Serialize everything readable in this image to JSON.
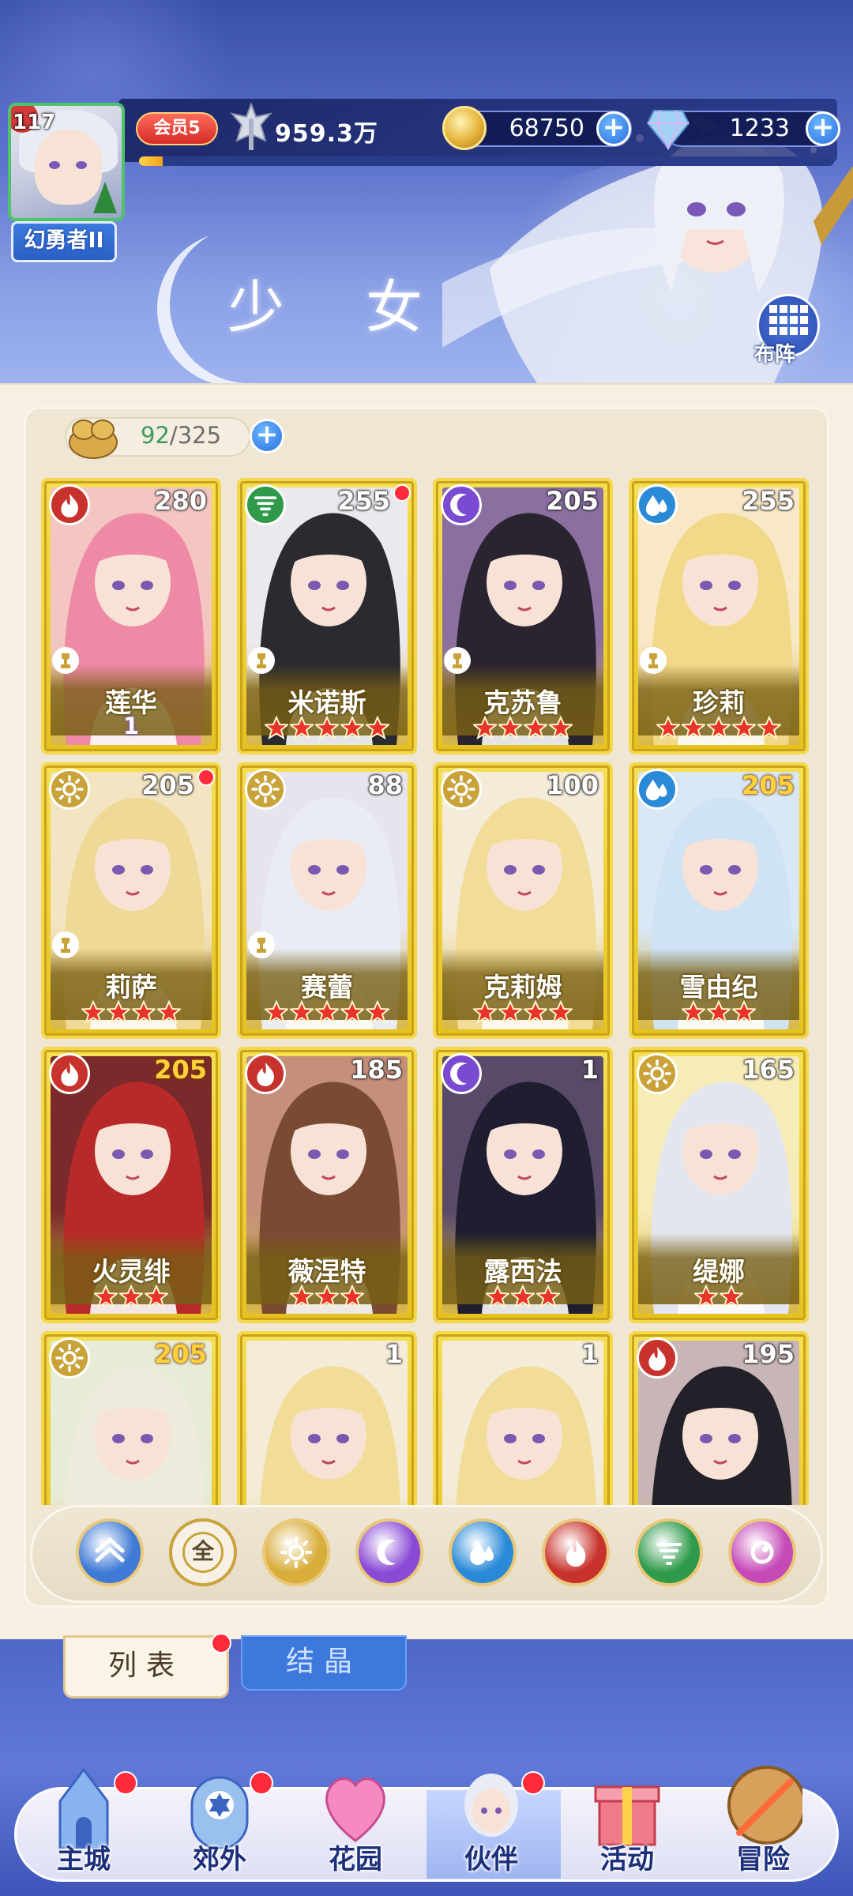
{
  "player": {
    "level": "117",
    "rank": "幻勇者II",
    "vip": "会员5",
    "power": "959.3万",
    "exp_progress": 0.034
  },
  "resources": {
    "coins": "68750",
    "gems": "1233"
  },
  "header": {
    "title": "少 女",
    "formation_label": "布阵"
  },
  "collection": {
    "owned": "92",
    "separator": "/",
    "capacity": "325"
  },
  "cards": [
    {
      "name": "莲华",
      "level": "280",
      "element": "fire",
      "stars": 0,
      "wing": "1",
      "gold": false,
      "dot": false,
      "chess": true
    },
    {
      "name": "米诺斯",
      "level": "255",
      "element": "wind",
      "stars": 5,
      "gold": false,
      "dot": true,
      "chess": true
    },
    {
      "name": "克苏鲁",
      "level": "205",
      "element": "moon",
      "stars": 4,
      "gold": false,
      "dot": false,
      "chess": true
    },
    {
      "name": "珍莉",
      "level": "255",
      "element": "water",
      "stars": 5,
      "gold": false,
      "dot": false,
      "chess": true
    },
    {
      "name": "莉萨",
      "level": "205",
      "element": "light",
      "stars": 4,
      "gold": false,
      "dot": true,
      "chess": true
    },
    {
      "name": "赛蕾",
      "level": "88",
      "element": "light",
      "stars": 5,
      "gold": false,
      "dot": false,
      "chess": true
    },
    {
      "name": "克莉姆",
      "level": "100",
      "element": "light",
      "stars": 4,
      "gold": false,
      "dot": false,
      "chess": false
    },
    {
      "name": "雪由纪",
      "level": "205",
      "element": "water",
      "stars": 3,
      "gold": true,
      "dot": false,
      "chess": false
    },
    {
      "name": "火灵绯",
      "level": "205",
      "element": "fire",
      "stars": 3,
      "gold": true,
      "dot": false,
      "chess": false
    },
    {
      "name": "薇涅特",
      "level": "185",
      "element": "fire",
      "stars": 3,
      "gold": false,
      "dot": false,
      "chess": false
    },
    {
      "name": "露西法",
      "level": "1",
      "element": "moon",
      "stars": 3,
      "gold": false,
      "dot": false,
      "chess": false
    },
    {
      "name": "缇娜",
      "level": "165",
      "element": "light",
      "stars": 2,
      "gold": false,
      "dot": false,
      "chess": false
    },
    {
      "name": "",
      "level": "205",
      "element": "light",
      "stars": 0,
      "gold": true,
      "dot": false,
      "chess": false
    },
    {
      "name": "",
      "level": "1",
      "element": "none",
      "stars": 0,
      "gold": false,
      "dot": false,
      "chess": false
    },
    {
      "name": "",
      "level": "1",
      "element": "none",
      "stars": 0,
      "gold": false,
      "dot": false,
      "chess": false
    },
    {
      "name": "",
      "level": "195",
      "element": "fire",
      "stars": 0,
      "gold": false,
      "dot": false,
      "chess": false
    }
  ],
  "filters": [
    {
      "id": "sort",
      "icon": "sort-arrows-icon",
      "label": ""
    },
    {
      "id": "all",
      "icon": "all-icon",
      "label": "全"
    },
    {
      "id": "light",
      "icon": "sun-icon",
      "label": ""
    },
    {
      "id": "moon",
      "icon": "moon-icon",
      "label": ""
    },
    {
      "id": "water",
      "icon": "water-drop-icon",
      "label": ""
    },
    {
      "id": "fire",
      "icon": "fire-icon",
      "label": ""
    },
    {
      "id": "wind",
      "icon": "whirlwind-icon",
      "label": ""
    },
    {
      "id": "dark",
      "icon": "dark-orb-icon",
      "label": ""
    }
  ],
  "tabs": {
    "list": "列表",
    "crystal": "结晶"
  },
  "nav": [
    {
      "label": "主城",
      "icon": "castle-icon",
      "dot": true
    },
    {
      "label": "郊外",
      "icon": "portal-icon",
      "dot": true
    },
    {
      "label": "花园",
      "icon": "heart-icon",
      "dot": false
    },
    {
      "label": "伙伴",
      "icon": "partner-icon",
      "dot": true,
      "active": true
    },
    {
      "label": "活动",
      "icon": "gift-icon",
      "dot": false
    },
    {
      "label": "冒险",
      "icon": "sword-icon",
      "dot": false
    }
  ],
  "colors": {
    "fire": "#c8322c",
    "wind": "#2e9a4a",
    "moon": "#7a4ad0",
    "water": "#2a8ad8",
    "light": "#c9a23a",
    "dark": "#c54ab8",
    "card_gold": "#f0d03a",
    "star_red": "#e8342a"
  }
}
